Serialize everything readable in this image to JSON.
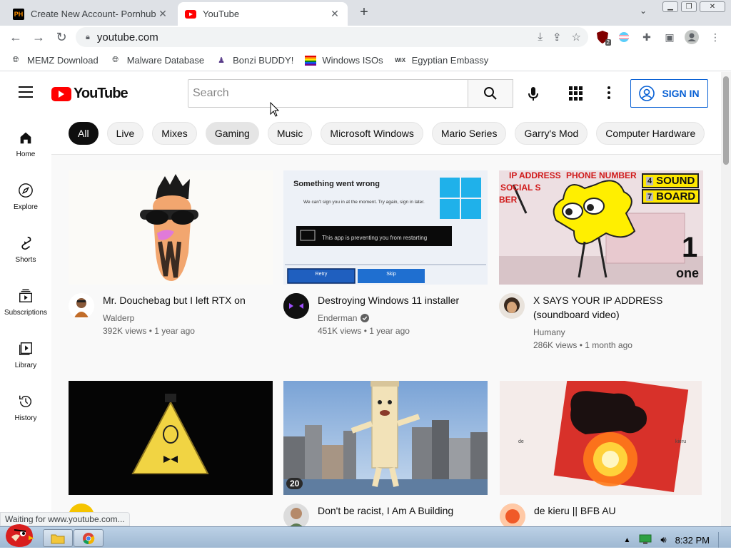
{
  "browser": {
    "tabs": [
      {
        "title": "Create New Account- Pornhub",
        "favicon": "PH",
        "active": false
      },
      {
        "title": "YouTube",
        "active": true
      }
    ],
    "url": "youtube.com",
    "bookmarks": [
      "MEMZ Download",
      "Malware Database",
      "Bonzi BUDDY!",
      "Windows ISOs",
      "Egyptian Embassy"
    ],
    "status": "Waiting for www.youtube.com...",
    "extension_badge": "2"
  },
  "youtube": {
    "logo_text": "YouTube",
    "search_placeholder": "Search",
    "sign_in": "SIGN IN",
    "chips": [
      "All",
      "Live",
      "Mixes",
      "Gaming",
      "Music",
      "Microsoft Windows",
      "Mario Series",
      "Garry's Mod",
      "Computer Hardware"
    ],
    "sidebar": [
      "Home",
      "Explore",
      "Shorts",
      "Subscriptions",
      "Library",
      "History"
    ],
    "videos": [
      {
        "title": "Mr. Douchebag but I left RTX on",
        "channel": "Walderp",
        "meta": "392K views • 1 year ago"
      },
      {
        "title": "Destroying Windows 11 installer",
        "channel": "Enderman",
        "meta": "451K views • 1 year ago",
        "verified": true,
        "thumb": {
          "heading": "Something went wrong",
          "body": "We can't sign you in at the moment. Try again, sign in later.",
          "bar": "This app is preventing you from restarting",
          "retry": "Retry",
          "skip": "Skip"
        }
      },
      {
        "title": "X SAYS YOUR IP ADDRESS (soundboard video)",
        "channel": "Humany",
        "meta": "286K views • 1 month ago",
        "thumb": {
          "t1": "IP ADDRESS",
          "t2": "PHONE NUMBER",
          "t3": "SOCIAL S",
          "t4": "BER",
          "b1": "4",
          "b1t": "SOUND",
          "b2": "7",
          "b2t": "BOARD",
          "n": "1",
          "one": "one"
        }
      },
      {
        "title": "",
        "channel": "",
        "meta": ""
      },
      {
        "title": "Don't be racist, I Am A Building",
        "channel": "",
        "meta": "",
        "badge": "20"
      },
      {
        "title": "de kieru || BFB AU",
        "channel": "",
        "meta": "",
        "thumb": {
          "l": "de",
          "r": "kieru"
        }
      }
    ]
  },
  "taskbar": {
    "time": "8:32 PM"
  }
}
